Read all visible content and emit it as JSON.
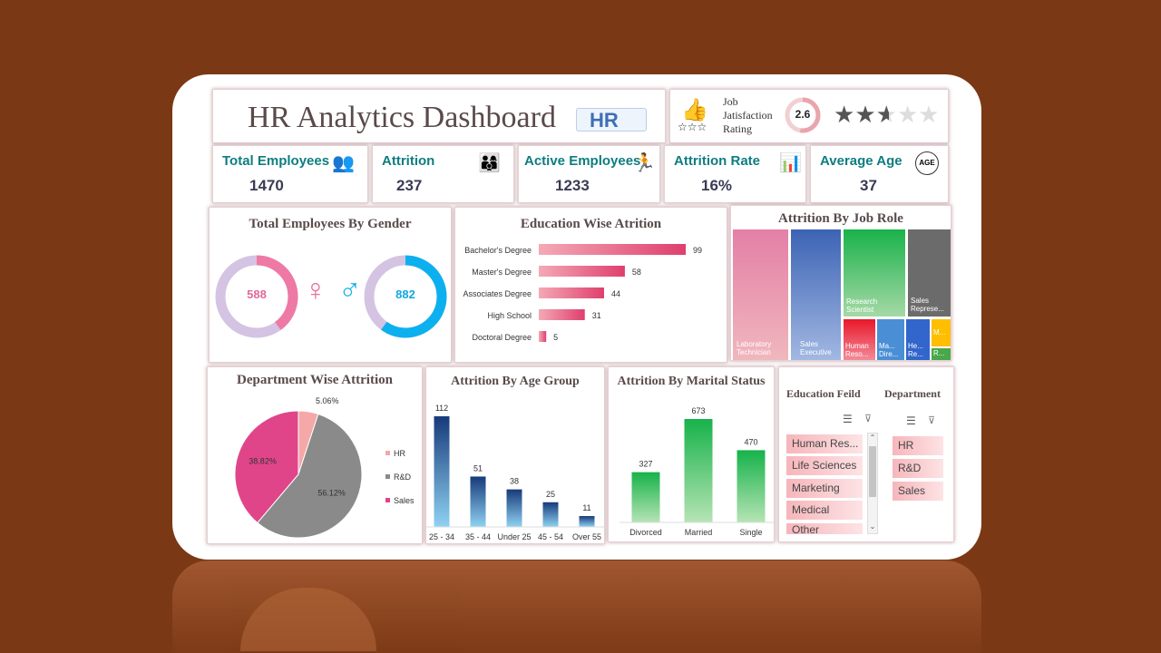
{
  "header": {
    "title": "HR Analytics Dashboard",
    "logo_text": "HR"
  },
  "satisfaction": {
    "label_line1": "Job",
    "label_line2": "Jatisfaction",
    "label_line3": "Rating",
    "value": "2.6",
    "rating_stars": 2.6,
    "max_stars": 5
  },
  "kpis": [
    {
      "label": "Total Employees",
      "value": "1470",
      "icon": "people-group-icon"
    },
    {
      "label": "Attrition",
      "value": "237",
      "icon": "people-leaving-icon"
    },
    {
      "label": "Active Employees",
      "value": "1233",
      "icon": "running-person-icon"
    },
    {
      "label": "Attrition Rate",
      "value": "16%",
      "icon": "presentation-board-icon"
    },
    {
      "label": "Average Age",
      "value": "37",
      "icon": "age-icon"
    }
  ],
  "age_icon_text": "AGE",
  "gender": {
    "title": "Total Employees By Gender",
    "female": "588",
    "male": "882"
  },
  "education": {
    "title": "Education Wise Atrition",
    "chart_data": {
      "type": "bar",
      "categories": [
        "Bachelor's Degree",
        "Master's Degree",
        "Associates Degree",
        "High School",
        "Doctoral Degree"
      ],
      "values": [
        99,
        58,
        44,
        31,
        5
      ]
    }
  },
  "job_role": {
    "title": "Attrition By Job Role",
    "labels": [
      "Laboratory Technician",
      "Sales Executive",
      "Research Scientist",
      "Sales Represe...",
      "Human Reso...",
      "Ma... Dire...",
      "He... Re...",
      "M...",
      "R..."
    ]
  },
  "department": {
    "title": "Department Wise Attrition",
    "chart_data": {
      "type": "pie",
      "categories": [
        "HR",
        "R&D",
        "Sales"
      ],
      "values": [
        5.06,
        56.12,
        38.82
      ],
      "labels": [
        "5.06%",
        "56.12%",
        "38.82%"
      ],
      "colors": [
        "#f4a8a8",
        "#8a8a8a",
        "#e0458a"
      ]
    }
  },
  "age_group": {
    "title": "Attrition By Age Group",
    "chart_data": {
      "type": "bar",
      "categories": [
        "25 - 34",
        "35 - 44",
        "Under 25",
        "45 - 54",
        "Over 55"
      ],
      "values": [
        112,
        51,
        38,
        25,
        11
      ]
    }
  },
  "marital": {
    "title": "Attrition By Marital Status",
    "chart_data": {
      "type": "bar",
      "categories": [
        "Divorced",
        "Married",
        "Single"
      ],
      "values": [
        327,
        673,
        470
      ]
    }
  },
  "slicers": {
    "education_title": "Education Feild",
    "department_title": "Department",
    "education_items": [
      "Human Res...",
      "Life Sciences",
      "Marketing",
      "Medical",
      "Other"
    ],
    "department_items": [
      "HR",
      "R&D",
      "Sales"
    ]
  }
}
